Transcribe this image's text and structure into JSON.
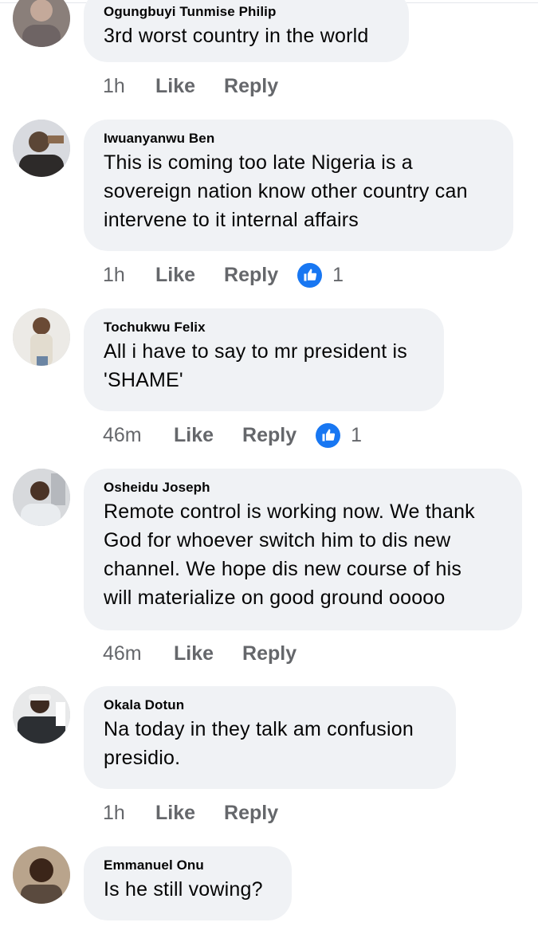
{
  "comments": [
    {
      "author": "Ogungbuyi Tunmise Philip",
      "text": [
        "3rd worst country in the world"
      ],
      "time": "1h",
      "like_label": "Like",
      "reply_label": "Reply",
      "reactions": null
    },
    {
      "author": "Iwuanyanwu Ben",
      "text": [
        "This is coming too late Nigeria is a",
        "sovereign nation know other country can",
        "intervene to it internal affairs"
      ],
      "time": "1h",
      "like_label": "Like",
      "reply_label": "Reply",
      "reactions": "1"
    },
    {
      "author": "Tochukwu Felix",
      "text": [
        "All i have to say to mr president is",
        "'SHAME'"
      ],
      "time": "46m",
      "like_label": "Like",
      "reply_label": "Reply",
      "reactions": "1"
    },
    {
      "author": "Osheidu Joseph",
      "text": [
        "Remote control is working now. We thank",
        "God for whoever switch him to dis new",
        "channel. We hope dis new course of his",
        "will materialize on good ground ooooo"
      ],
      "time": "46m",
      "like_label": "Like",
      "reply_label": "Reply",
      "reactions": null
    },
    {
      "author": "Okala Dotun",
      "text": [
        "Na today in they talk am confusion",
        "presidio."
      ],
      "time": "1h",
      "like_label": "Like",
      "reply_label": "Reply",
      "reactions": null
    },
    {
      "author": "Emmanuel Onu",
      "text": [
        "Is he still vowing?"
      ],
      "time": "",
      "like_label": "",
      "reply_label": "",
      "reactions": null
    }
  ],
  "icons": {
    "reaction": "like-reaction-icon",
    "avatar": "profile-photo"
  },
  "colors": {
    "bubble": "#f0f2f5",
    "meta": "#65676b",
    "like": "#1877f2"
  }
}
